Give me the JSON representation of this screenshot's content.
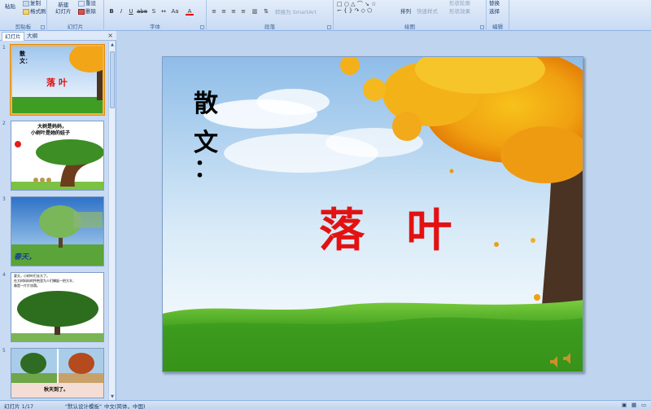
{
  "ribbon": {
    "clipboard": {
      "label": "剪贴板",
      "paste": "粘贴",
      "format_painter": "格式刷",
      "copy": "复制"
    },
    "slides": {
      "label": "幻灯片",
      "new_slide": "新建",
      "new_slide_line2": "幻灯片",
      "reset": "重设",
      "delete": "删除"
    },
    "font": {
      "label": "字体"
    },
    "paragraph": {
      "label": "段落",
      "convert_smartart": "转换为 SmartArt"
    },
    "drawing": {
      "label": "绘图",
      "arrange": "排列",
      "quick_styles": "快速样式",
      "shape_fill": "形状轮廓",
      "shape_effect": "形状效果"
    },
    "editing": {
      "label": "编辑",
      "replace": "替换",
      "select": "选择"
    }
  },
  "panel": {
    "tab_slides": "幻灯片",
    "tab_outline": "大纲",
    "close": "×",
    "thumbnails": [
      {
        "num": "1",
        "title": "落 叶",
        "text": "散文："
      },
      {
        "num": "2",
        "text_line1": "大树是妈妈，",
        "text_line2": "小树叶是她的娃子"
      },
      {
        "num": "3",
        "text": "春天，"
      },
      {
        "num": "4",
        "text_line1": "夏天，小树叶们长大了。",
        "text_line2": "在大树妈妈的怀抱里为人们撑起一把大伞，",
        "text_line3": "像是一片片凉荫。"
      },
      {
        "num": "5",
        "text": "秋天到了。"
      }
    ]
  },
  "slide": {
    "label_chars": [
      "散",
      "文",
      "："
    ],
    "title": "落 叶"
  },
  "status": {
    "slide_count": "幻灯片 1/17",
    "theme": "\"默认设计模板\"",
    "language": "中文(简体，中国)"
  },
  "colors": {
    "title_red": "#e31212",
    "ribbon_blue": "#d5e3f6",
    "selected_border": "#f0b44a"
  }
}
